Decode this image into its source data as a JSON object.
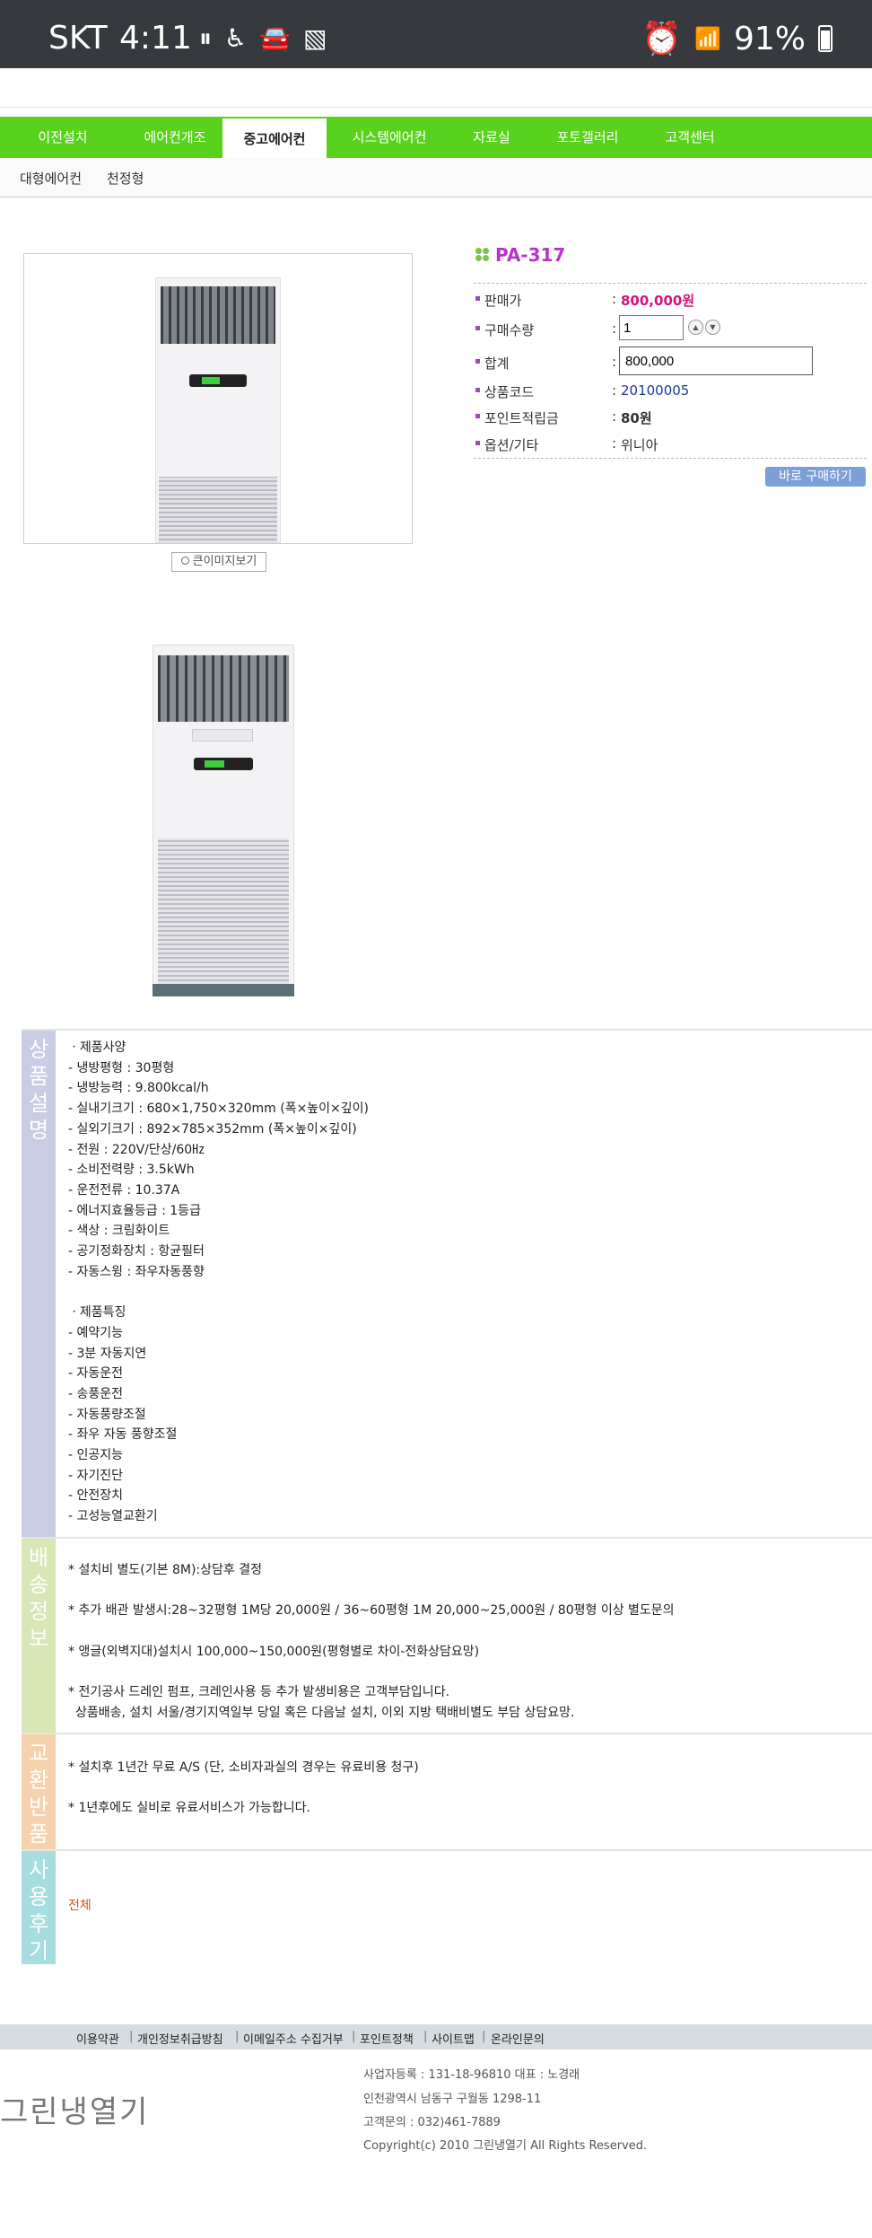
{
  "status_bar": {
    "carrier": "SKT",
    "time": "4:11",
    "battery": "91%"
  },
  "nav": {
    "tabs": [
      "이전설치",
      "에어컨개조",
      "중고에어컨",
      "시스템에어컨",
      "자료실",
      "포토갤러리",
      "고객센터"
    ],
    "active_tab": "중고에어컨",
    "sub_tabs": [
      "대형에어컨",
      "천정형"
    ]
  },
  "product": {
    "zoom_label": "큰이미지보기",
    "name": "PA-317",
    "fields": {
      "price_label": "판매가",
      "price": "800,000원",
      "qty_label": "구매수량",
      "qty": "1",
      "total_label": "합계",
      "total": "800,000",
      "code_label": "상품코드",
      "code": "20100005",
      "points_label": "포인트적립금",
      "points": "80원",
      "option_label": "옵션/기타",
      "option": "위니아"
    },
    "buy_label": "바로 구매하기"
  },
  "description": {
    "side_label": [
      "상",
      "품",
      "설",
      "명"
    ],
    "spec_lines": [
      "ㆍ제품사양",
      "- 냉방평형 : 30평형",
      "- 냉방능력 : 9.800kcal/h",
      "- 실내기크기 : 680×1,750×320mm (폭×높이×깊이)",
      "- 실외기크기 : 892×785×352mm (폭×높이×깊이)",
      "- 전원 : 220V/단상/60㎐",
      "- 소비전력량 : 3.5kWh",
      "- 운전전류 : 10.37A",
      "- 에너지효율등급 : 1등급",
      "- 색상 : 크림화이트",
      "- 공기정화장치 : 항균필터",
      "- 자동스윙 : 좌우자동풍향"
    ],
    "feature_lines": [
      "ㆍ제품특징",
      "- 예약기능",
      "- 3분 자동지연",
      "- 자동운전",
      "- 송풍운전",
      "- 자동풍량조절",
      "- 좌우 자동 풍향조절",
      "- 인공지능",
      "- 자기진단",
      "- 안전장치",
      "- 고성능열교환기"
    ]
  },
  "delivery": {
    "side_label": [
      "배",
      "송",
      "정",
      "보"
    ],
    "lines": [
      "* 설치비 별도(기본 8M):상담후 결정",
      "* 추가 배관 발생시:28~32평형 1M당 20,000원 / 36~60평형 1M 20,000~25,000원 / 80평형 이상 별도문의",
      "* 앵글(외벽지대)설치시 100,000~150,000원(평형별로 차이-전화상담요망)",
      "* 전기공사 드레인 펌프, 크레인사용 등 추가 발생비용은 고객부담입니다.",
      "상품배송, 설치 서울/경기지역일부 당일 혹은 다음날 설치, 이외 지방 택배비별도 부담 상담요망."
    ]
  },
  "exchange": {
    "side_label": [
      "교",
      "환",
      "반",
      "품"
    ],
    "lines": [
      "* 설치후 1년간 무료 A/S (단, 소비자과실의 경우는 유료비용 청구)",
      "* 1년후에도 실비로 유료서비스가 가능합니다."
    ]
  },
  "reviews": {
    "side_label": [
      "사",
      "용",
      "후",
      "기"
    ],
    "all_link": "전체"
  },
  "footer": {
    "links": [
      "이용약관",
      "개인정보취급방침",
      "이메일주소 수집거부",
      "포인트정책",
      "사이트맵",
      "온라인문의"
    ],
    "logo": "그린냉열기",
    "info": [
      "사업자등록 : 131-18-96810   대표 : 노경래",
      "인천광역시 남동구 구월동 1298-11",
      "고객문의 : 032)461-7889",
      "Copyright(c) 2010   그린냉열기   All Rights Reserved."
    ]
  },
  "colors": {
    "nav_green": "#58d21c",
    "price": "#d3137b",
    "title": "#b535c7",
    "buy_button": "#7b9fd6",
    "side_desc": "#c9cce4",
    "side_delivery": "#d9e6b6",
    "side_exchange": "#f5d2ad",
    "side_reviews": "#a5dde0"
  }
}
